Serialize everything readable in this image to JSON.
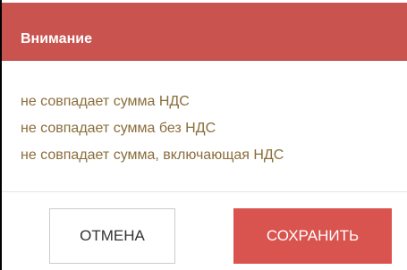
{
  "dialog": {
    "title": "Внимание",
    "messages": [
      "не совпадает сумма НДС",
      "не совпадает сумма без НДС",
      "не совпадает сумма, включающая НДС"
    ],
    "buttons": {
      "cancel_label": "ОТМЕНА",
      "save_label": "СОХРАНИТЬ"
    },
    "colors": {
      "header_bg": "#c9534f",
      "message_text": "#8a6d3b",
      "save_bg": "#d9534f"
    }
  }
}
